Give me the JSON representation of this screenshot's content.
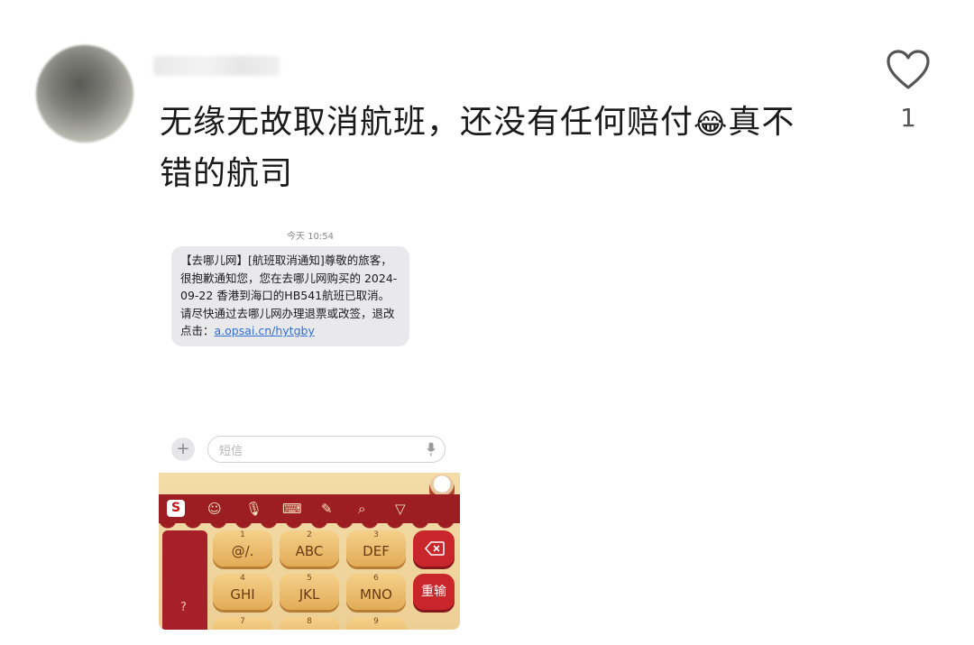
{
  "comment": {
    "text_before_emoji": "无缘无故取消航班，还没有任何赔付",
    "emoji": "😂",
    "text_after_emoji": "真不错的航司",
    "likes": "1",
    "like_icon": "heart-outline-icon"
  },
  "sms": {
    "time": "今天 10:54",
    "message": "【去哪儿网】[航班取消通知]尊敬的旅客，很抱歉通知您，您在去哪儿网购买的 2024-09-22 香港到海口的HB541航班已取消。请尽快通过去哪儿网办理退票或改签，退改点击：",
    "link": "a.opsai.cn/hytgby",
    "plus_icon": "plus-icon",
    "input_placeholder": "短信",
    "mic_icon": "microphone-icon"
  },
  "keyboard": {
    "colors": {
      "bar": "#9c1d22",
      "key": "#e8b866",
      "action": "#c8262a",
      "background": "#f0d6a0"
    },
    "toolbar": {
      "logo": "S",
      "emoji_icon": "☺",
      "voice_icon": "🎙",
      "keyboard_icon": "⌨",
      "handwrite_icon": "✎",
      "search_icon": "⌕",
      "collapse_icon": "▽"
    },
    "left_column_symbol": "?",
    "keys": [
      {
        "num": "1",
        "label": "@/."
      },
      {
        "num": "2",
        "label": "ABC"
      },
      {
        "num": "3",
        "label": "DEF"
      },
      {
        "num": "4",
        "label": "GHI"
      },
      {
        "num": "5",
        "label": "JKL"
      },
      {
        "num": "6",
        "label": "MNO"
      },
      {
        "num": "7",
        "label": ""
      },
      {
        "num": "8",
        "label": ""
      },
      {
        "num": "9",
        "label": ""
      }
    ],
    "backspace_icon": "backspace-icon",
    "retype_label": "重输"
  }
}
